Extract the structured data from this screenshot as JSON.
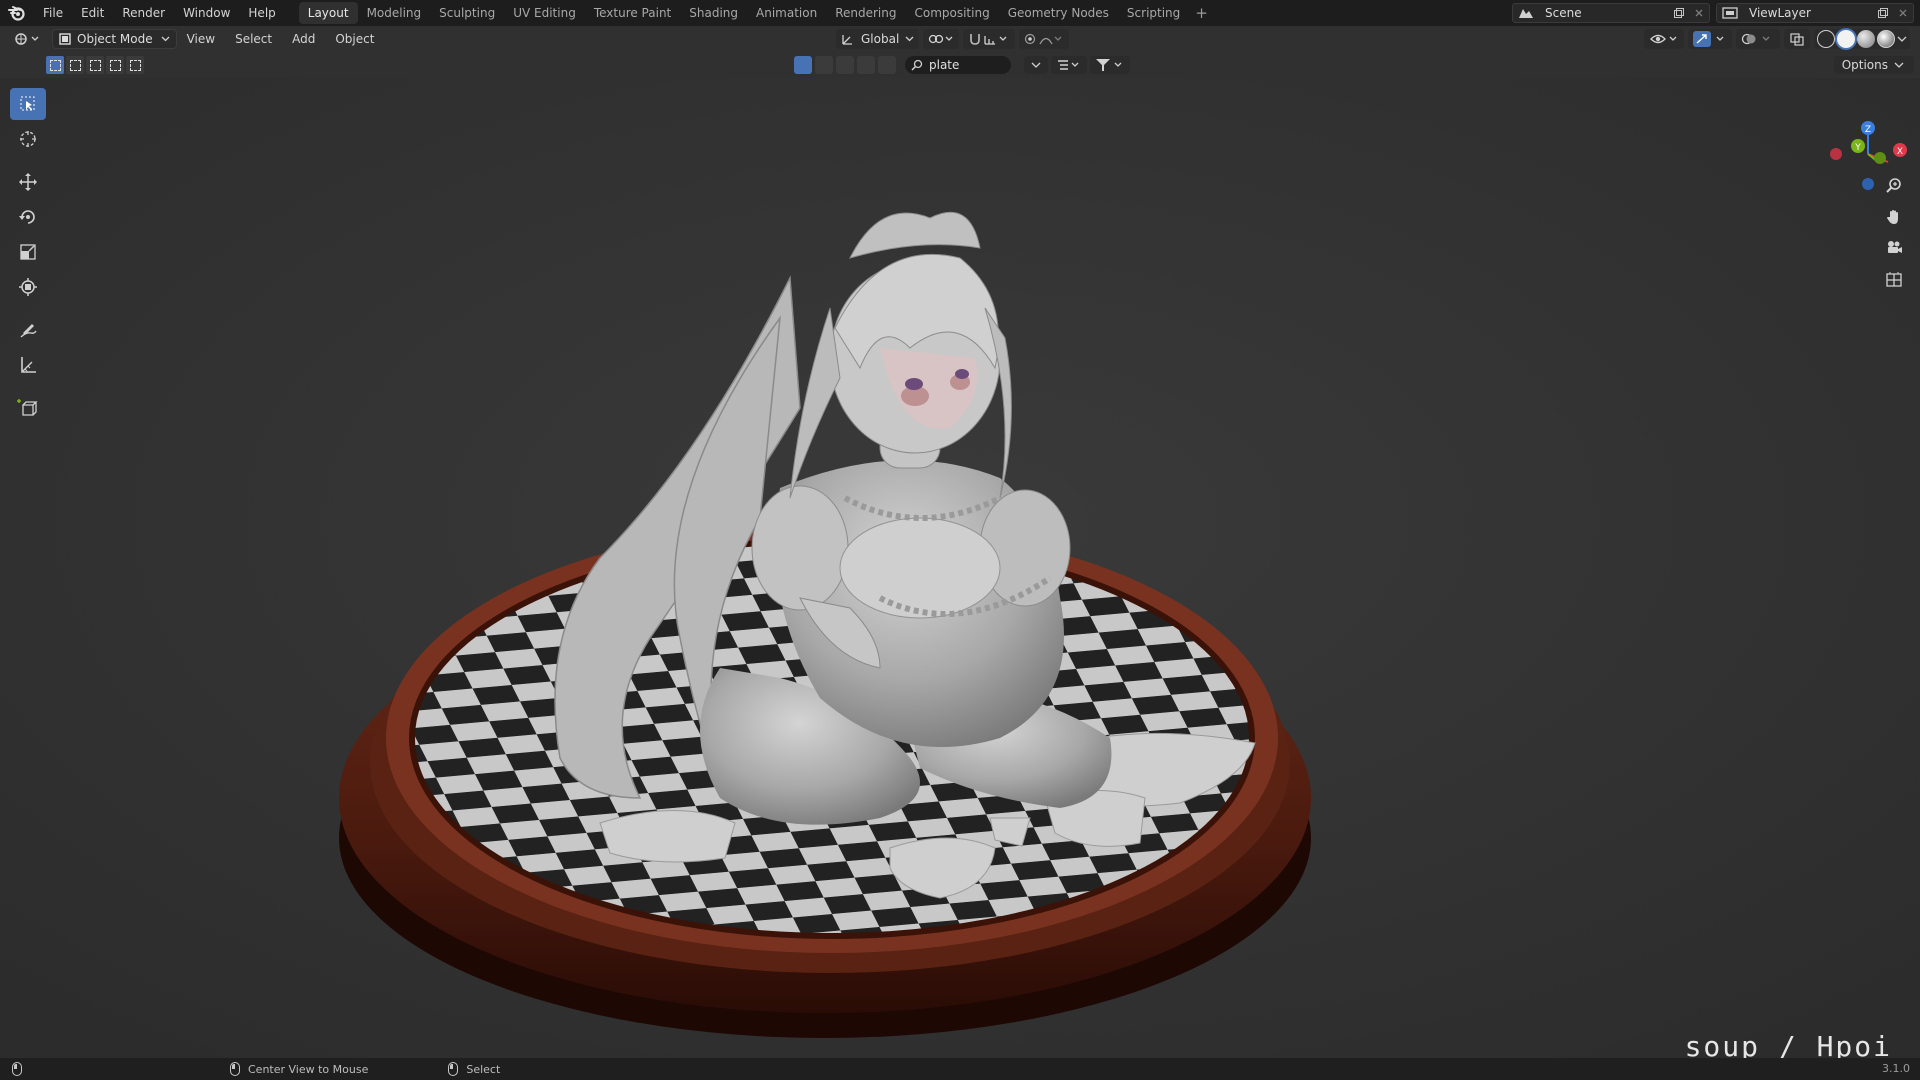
{
  "topbar": {
    "menus": [
      "File",
      "Edit",
      "Render",
      "Window",
      "Help"
    ],
    "workspaces": [
      "Layout",
      "Modeling",
      "Sculpting",
      "UV Editing",
      "Texture Paint",
      "Shading",
      "Animation",
      "Rendering",
      "Compositing",
      "Geometry Nodes",
      "Scripting"
    ],
    "active_workspace": "Layout",
    "add_workspace": "+",
    "scene": "Scene",
    "view_layer": "ViewLayer"
  },
  "header": {
    "mode": "Object Mode",
    "menus": [
      "View",
      "Select",
      "Add",
      "Object"
    ],
    "transform_orientation": "Global",
    "search_filter": "plate",
    "options_label": "Options"
  },
  "gizmo": {
    "x": "X",
    "y": "Y",
    "z": "Z"
  },
  "watermark": "soup / Hpoi",
  "statusbar": {
    "middle_mouse": "Center View to Mouse",
    "left_mouse": "Select",
    "version": "3.1.0"
  },
  "colors": {
    "accent": "#4772b3",
    "viewport_bg": "#303030",
    "bar_bg": "#1d1d1d",
    "axis_x": "#e0394b",
    "axis_y": "#7ab418",
    "axis_z": "#3a7ee0"
  }
}
